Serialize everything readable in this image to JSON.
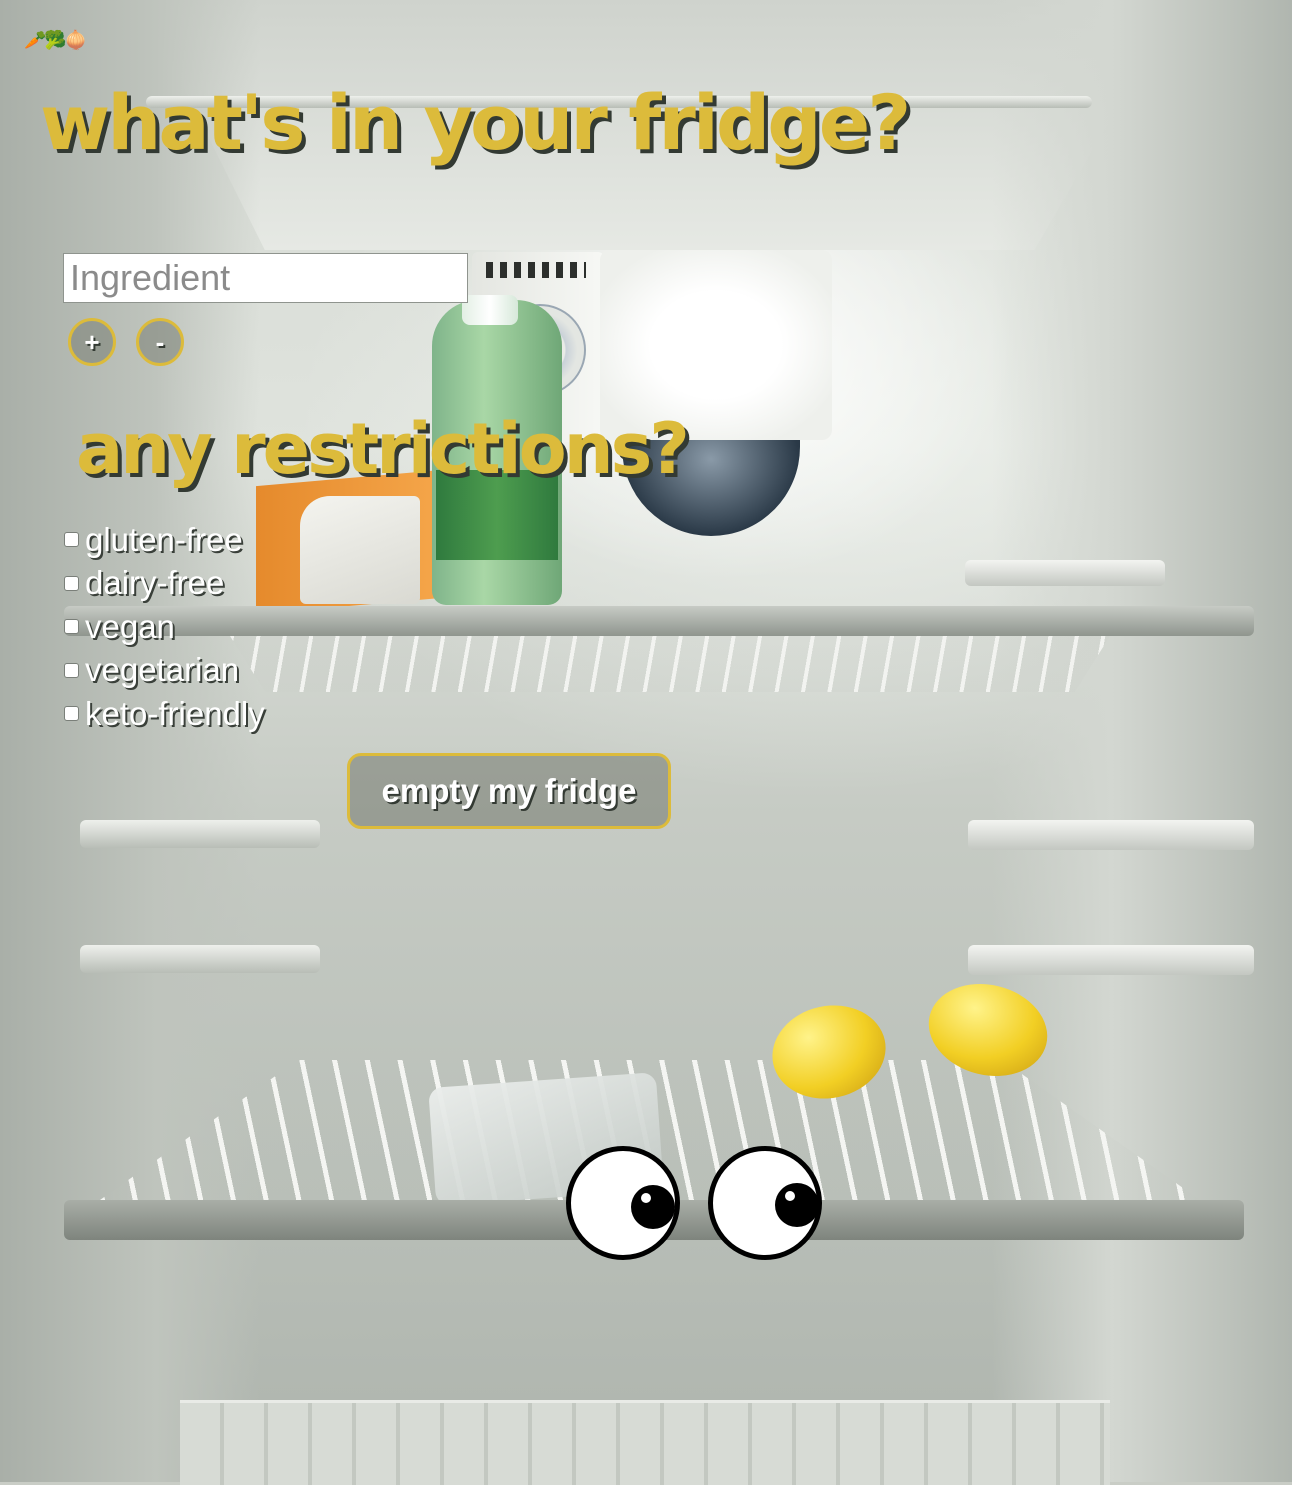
{
  "app_icons": "🥕🥦🧅",
  "title": "what's in your fridge?",
  "ingredient_input": {
    "placeholder": "Ingredient",
    "value": ""
  },
  "buttons": {
    "add": "+",
    "remove": "-",
    "empty": "empty my fridge"
  },
  "restrictions_title": "any restrictions?",
  "restrictions": [
    {
      "label": "gluten-free",
      "checked": false
    },
    {
      "label": "dairy-free",
      "checked": false
    },
    {
      "label": "vegan",
      "checked": false
    },
    {
      "label": "vegetarian",
      "checked": false
    },
    {
      "label": "keto-friendly",
      "checked": false
    }
  ],
  "colors": {
    "accent": "#dcbb3b",
    "shadow": "#333a33",
    "text": "#ffffff"
  },
  "icons": [
    "carrot-icon",
    "broccoli-icon",
    "onion-icon",
    "googly-eye-icon"
  ]
}
